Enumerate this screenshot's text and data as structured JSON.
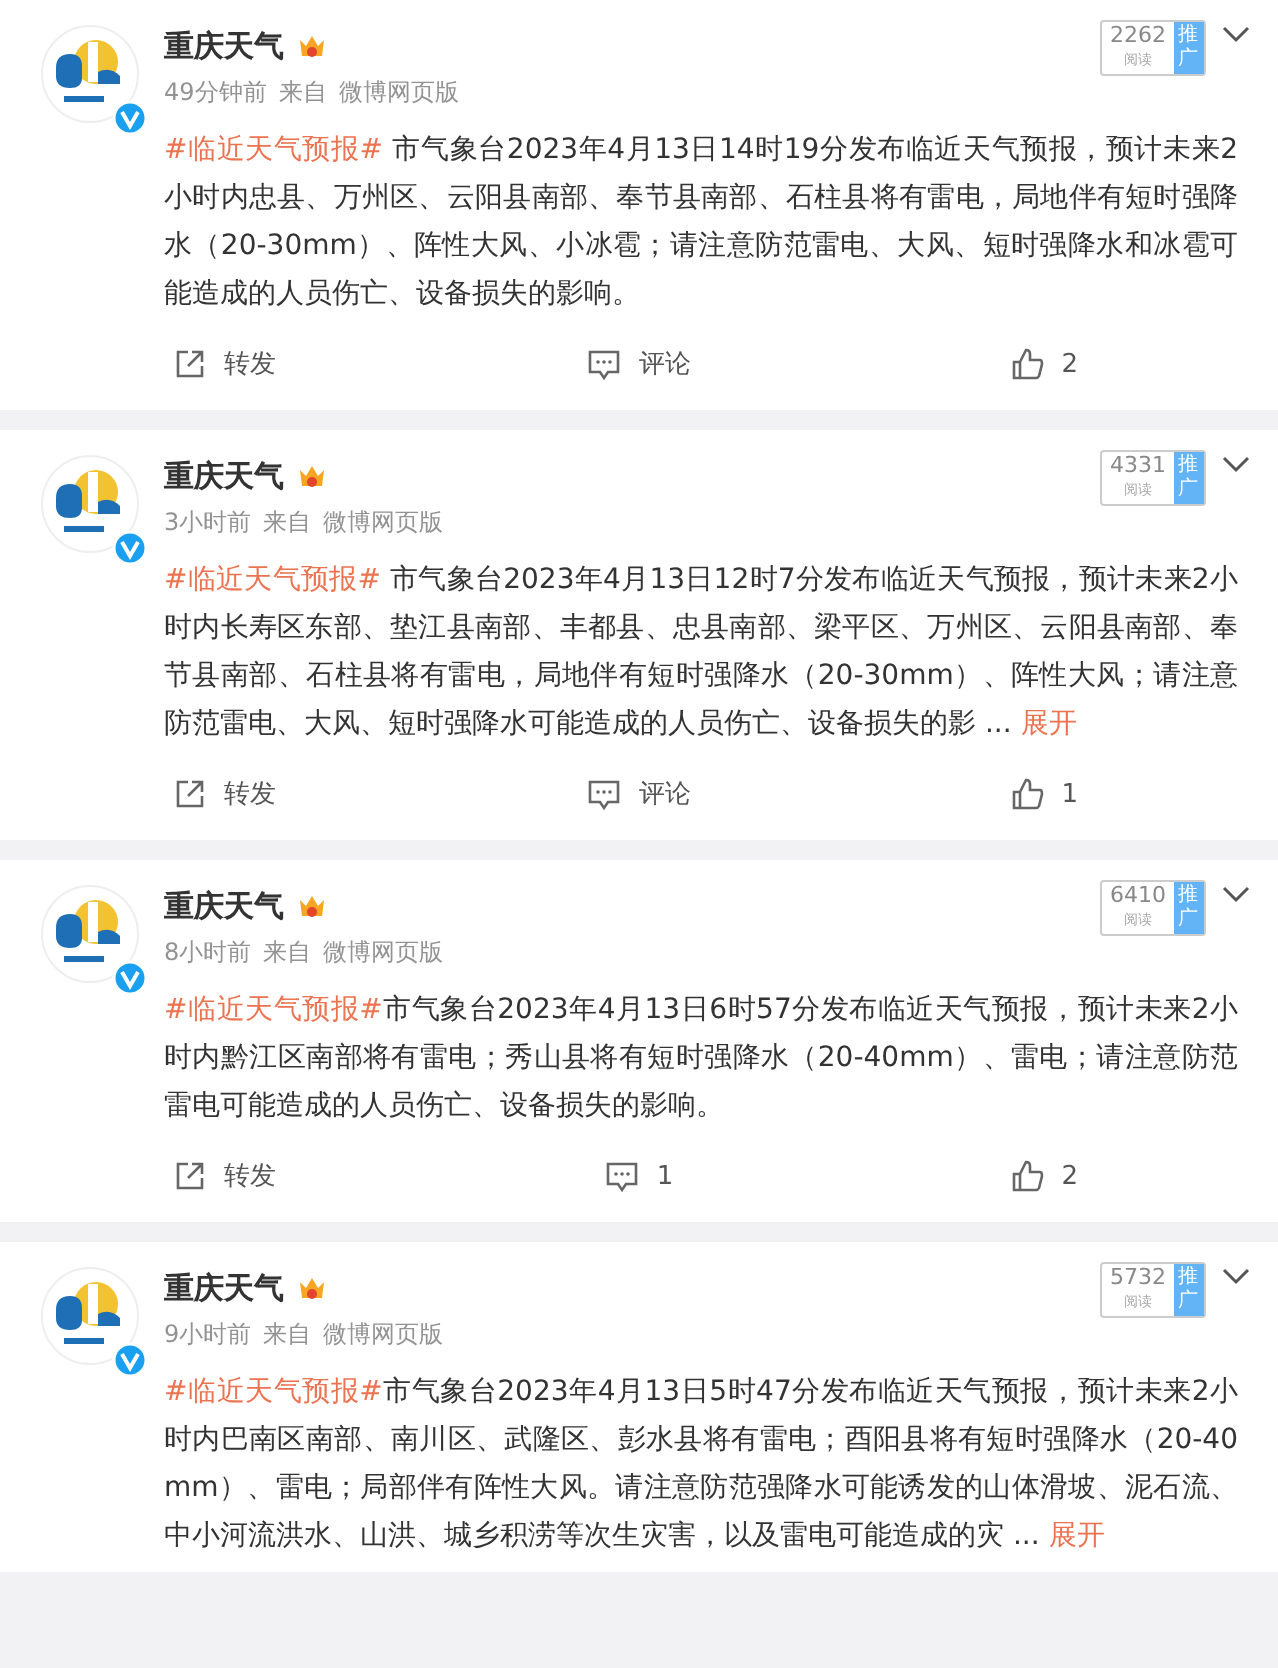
{
  "posts": [
    {
      "author": "重庆天气",
      "time": "49分钟前",
      "source_prefix": "来自",
      "source": "微博网页版",
      "reads": "2262",
      "reads_label": "阅读",
      "promote": "推广",
      "hashtag": "#临近天气预报#",
      "body": " 市气象台2023年4月13日14时19分发布临近天气预报，预计未来2小时内忠县、万州区、云阳县南部、奉节县南部、石柱县将有雷电，局地伴有短时强降水（20-30mm）、阵性大风、小冰雹；请注意防范雷电、大风、短时强降水和冰雹可能造成的人员伤亡、设备损失的影响。",
      "repost": "转发",
      "comment": "评论",
      "likes": "2"
    },
    {
      "author": "重庆天气",
      "time": "3小时前",
      "source_prefix": "来自",
      "source": "微博网页版",
      "reads": "4331",
      "reads_label": "阅读",
      "promote": "推广",
      "hashtag": "#临近天气预报#",
      "body": " 市气象台2023年4月13日12时7分发布临近天气预报，预计未来2小时内长寿区东部、垫江县南部、丰都县、忠县南部、梁平区、万州区、云阳县南部、奉节县南部、石柱县将有雷电，局地伴有短时强降水（20-30mm）、阵性大风；请注意防范雷电、大风、短时强降水可能造成的人员伤亡、设备损失的影",
      "ellipsis": " ...",
      "expand": "展开",
      "repost": "转发",
      "comment": "评论",
      "likes": "1"
    },
    {
      "author": "重庆天气",
      "time": "8小时前",
      "source_prefix": "来自",
      "source": "微博网页版",
      "reads": "6410",
      "reads_label": "阅读",
      "promote": "推广",
      "hashtag": "#临近天气预报#",
      "body": "市气象台2023年4月13日6时57分发布临近天气预报，预计未来2小时内黔江区南部将有雷电；秀山县将有短时强降水（20-40mm）、雷电；请注意防范雷电可能造成的人员伤亡、设备损失的影响。",
      "repost": "转发",
      "comment": "1",
      "likes": "2"
    },
    {
      "author": "重庆天气",
      "time": "9小时前",
      "source_prefix": "来自",
      "source": "微博网页版",
      "reads": "5732",
      "reads_label": "阅读",
      "promote": "推广",
      "hashtag": "#临近天气预报#",
      "body": "市气象台2023年4月13日5时47分发布临近天气预报，预计未来2小时内巴南区南部、南川区、武隆区、彭水县将有雷电；酉阳县将有短时强降水（20-40mm）、雷电；局部伴有阵性大风。请注意防范强降水可能诱发的山体滑坡、泥石流、中小河流洪水、山洪、城乡积涝等次生灾害，以及雷电可能造成的灾",
      "ellipsis": " ...",
      "expand": "展开"
    }
  ]
}
